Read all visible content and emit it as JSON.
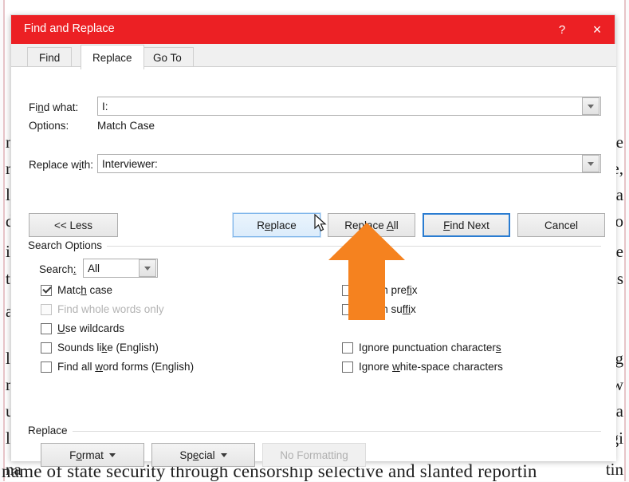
{
  "dialog": {
    "title": "Find and Replace",
    "help_label": "?",
    "close_label": "×",
    "tabs": [
      {
        "label": "Find",
        "active": false
      },
      {
        "label": "Replace",
        "active": true
      },
      {
        "label": "Go To",
        "active": false
      }
    ],
    "find": {
      "label": "Find what:",
      "value": "I:",
      "options_label": "Options:",
      "options_value": "Match Case"
    },
    "replace_field": {
      "label": "Replace with:",
      "value": "Interviewer:"
    },
    "action_buttons": {
      "less": "<< Less",
      "replace": "Replace",
      "replace_all": "Replace All",
      "find_next": "Find Next",
      "cancel": "Cancel"
    },
    "search_options": {
      "group_label": "Search Options",
      "search_label": "Search:",
      "search_value": "All",
      "left_checks": [
        {
          "label": "Match case",
          "checked": true,
          "disabled": false
        },
        {
          "label": "Find whole words only",
          "checked": false,
          "disabled": true
        },
        {
          "label": "Use wildcards",
          "checked": false,
          "disabled": false
        },
        {
          "label": "Sounds like (English)",
          "checked": false,
          "disabled": false
        },
        {
          "label": "Find all word forms (English)",
          "checked": false,
          "disabled": false
        }
      ],
      "right_checks": [
        {
          "label": "prefix",
          "checked": false,
          "disabled": false
        },
        {
          "label": "suffix",
          "checked": false,
          "disabled": false
        },
        {
          "label": "Ignore punctuation characters",
          "checked": false,
          "disabled": false
        },
        {
          "label": "Ignore white-space characters",
          "checked": false,
          "disabled": false
        }
      ]
    },
    "replace_group": {
      "group_label": "Replace",
      "format_button": "Format",
      "special_button": "Special",
      "no_formatting_button": "No Formatting"
    },
    "colors": {
      "titlebar": "#ec2024",
      "accent_default_button": "#2a7cd1",
      "overlay_arrow": "#f5821f"
    }
  },
  "document_background": {
    "left_fragments": [
      "n t",
      "rt",
      "l",
      "da",
      "in",
      "th",
      "a",
      "le",
      "rc",
      "us",
      "lo",
      "na"
    ],
    "right_fragments": [
      "ie",
      "e,",
      "ca",
      "co",
      "e",
      "es",
      "g",
      "w",
      "a",
      "gi",
      "tin"
    ],
    "bottom_line": "name of state security through censorship selective and slanted reportin"
  }
}
